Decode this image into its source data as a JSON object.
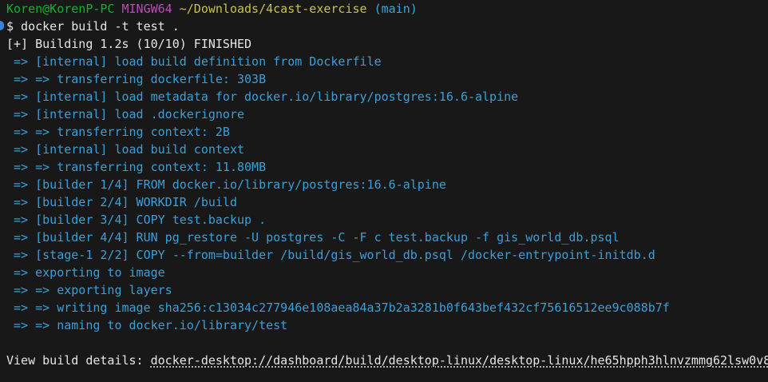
{
  "prompt": {
    "user": "Koren@KorenP-PC",
    "host": "MINGW64",
    "path": "~/Downloads/4cast-exercise",
    "branch": "(main)"
  },
  "command": "$ docker build -t test .",
  "status": "[+] Building 1.2s (10/10) FINISHED",
  "steps": [
    " => [internal] load build definition from Dockerfile",
    " => => transferring dockerfile: 303B",
    " => [internal] load metadata for docker.io/library/postgres:16.6-alpine",
    " => [internal] load .dockerignore",
    " => => transferring context: 2B",
    " => [internal] load build context",
    " => => transferring context: 11.80MB",
    " => [builder 1/4] FROM docker.io/library/postgres:16.6-alpine",
    " => [builder 2/4] WORKDIR /build",
    " => [builder 3/4] COPY test.backup .",
    " => [builder 4/4] RUN pg_restore -U postgres -C -F c test.backup -f gis_world_db.psql",
    " => [stage-1 2/2] COPY --from=builder /build/gis_world_db.psql /docker-entrypoint-initdb.d",
    " => exporting to image",
    " => => exporting layers",
    " => => writing image sha256:c13034c277946e108aea84a37b2a3281b0f643bef432cf75616512ee9c088b7f",
    " => => naming to docker.io/library/test"
  ],
  "details": {
    "label": "View build details: ",
    "link": "docker-desktop://dashboard/build/desktop-linux/desktop-linux/he65hpph3hlnvzmmg62lsw0v8"
  },
  "colors": {
    "background": "#181818",
    "user": "#12b12b",
    "host": "#b84cb8",
    "path": "#c6c34c",
    "branch": "#3aa6d8",
    "step": "#3a9fd8",
    "marker": "#3a83d8"
  }
}
